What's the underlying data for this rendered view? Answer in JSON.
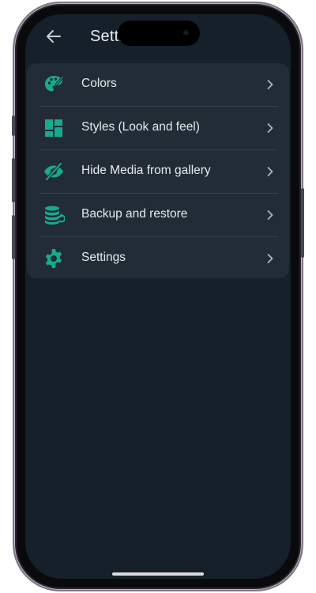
{
  "appbar": {
    "title": "Settings"
  },
  "menu": {
    "items": [
      {
        "label": "Colors",
        "icon": "palette-icon"
      },
      {
        "label": "Styles (Look and feel)",
        "icon": "dashboard-icon"
      },
      {
        "label": "Hide Media from gallery",
        "icon": "eye-off-icon"
      },
      {
        "label": "Backup and restore",
        "icon": "database-icon"
      },
      {
        "label": "Settings",
        "icon": "gear-icon"
      }
    ]
  },
  "colors": {
    "accent": "#19a98c",
    "background": "#16202b",
    "card": "#222c37",
    "text": "#e6eaee"
  }
}
